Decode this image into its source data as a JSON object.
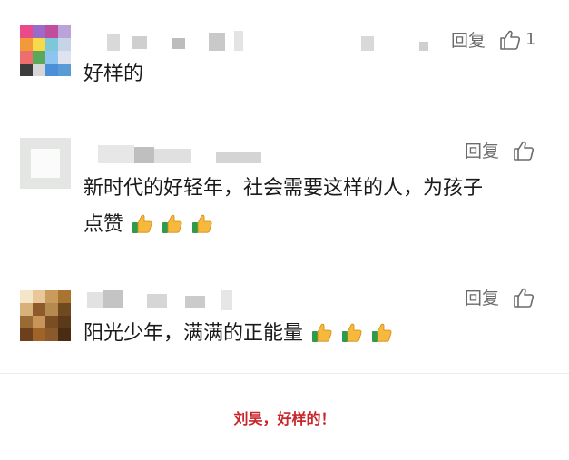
{
  "comments": [
    {
      "reply_label": "回复",
      "like_count": "1",
      "text": "好样的",
      "avatar_colors": [
        "#e84a8a",
        "#9b6bc9",
        "#c14e9c",
        "#b9a3d8",
        "#f29a3a",
        "#f7d94c",
        "#7cc8d8",
        "#c7d3e6",
        "#ee6d6d",
        "#5aa85a",
        "#8ec5f0",
        "#dfe3f0",
        "#3c3c3c",
        "#d6d6d6",
        "#4a90d9",
        "#5b9bd5"
      ]
    },
    {
      "reply_label": "回复",
      "like_count": "",
      "text_lines": [
        "新时代的好轻年，社会需要这样的人，为孩子",
        "点赞"
      ]
    },
    {
      "reply_label": "回复",
      "like_count": "",
      "text": "阳光少年，满满的正能量",
      "avatar_colors": [
        "#f4e7c9",
        "#e9c79a",
        "#c99b5c",
        "#a8742f",
        "#d8b07a",
        "#8c5a2b",
        "#b58a4e",
        "#6f4a1f",
        "#9a6a35",
        "#c8945a",
        "#7a4d24",
        "#5b3a1a",
        "#6e3f1c",
        "#a06428",
        "#8b5a2c",
        "#4a2c12"
      ]
    }
  ],
  "caption": "刘昊，好样的！",
  "icons": {
    "like": "thumbs-up-outline-icon",
    "emoji": "thumbs-up-emoji-icon"
  }
}
